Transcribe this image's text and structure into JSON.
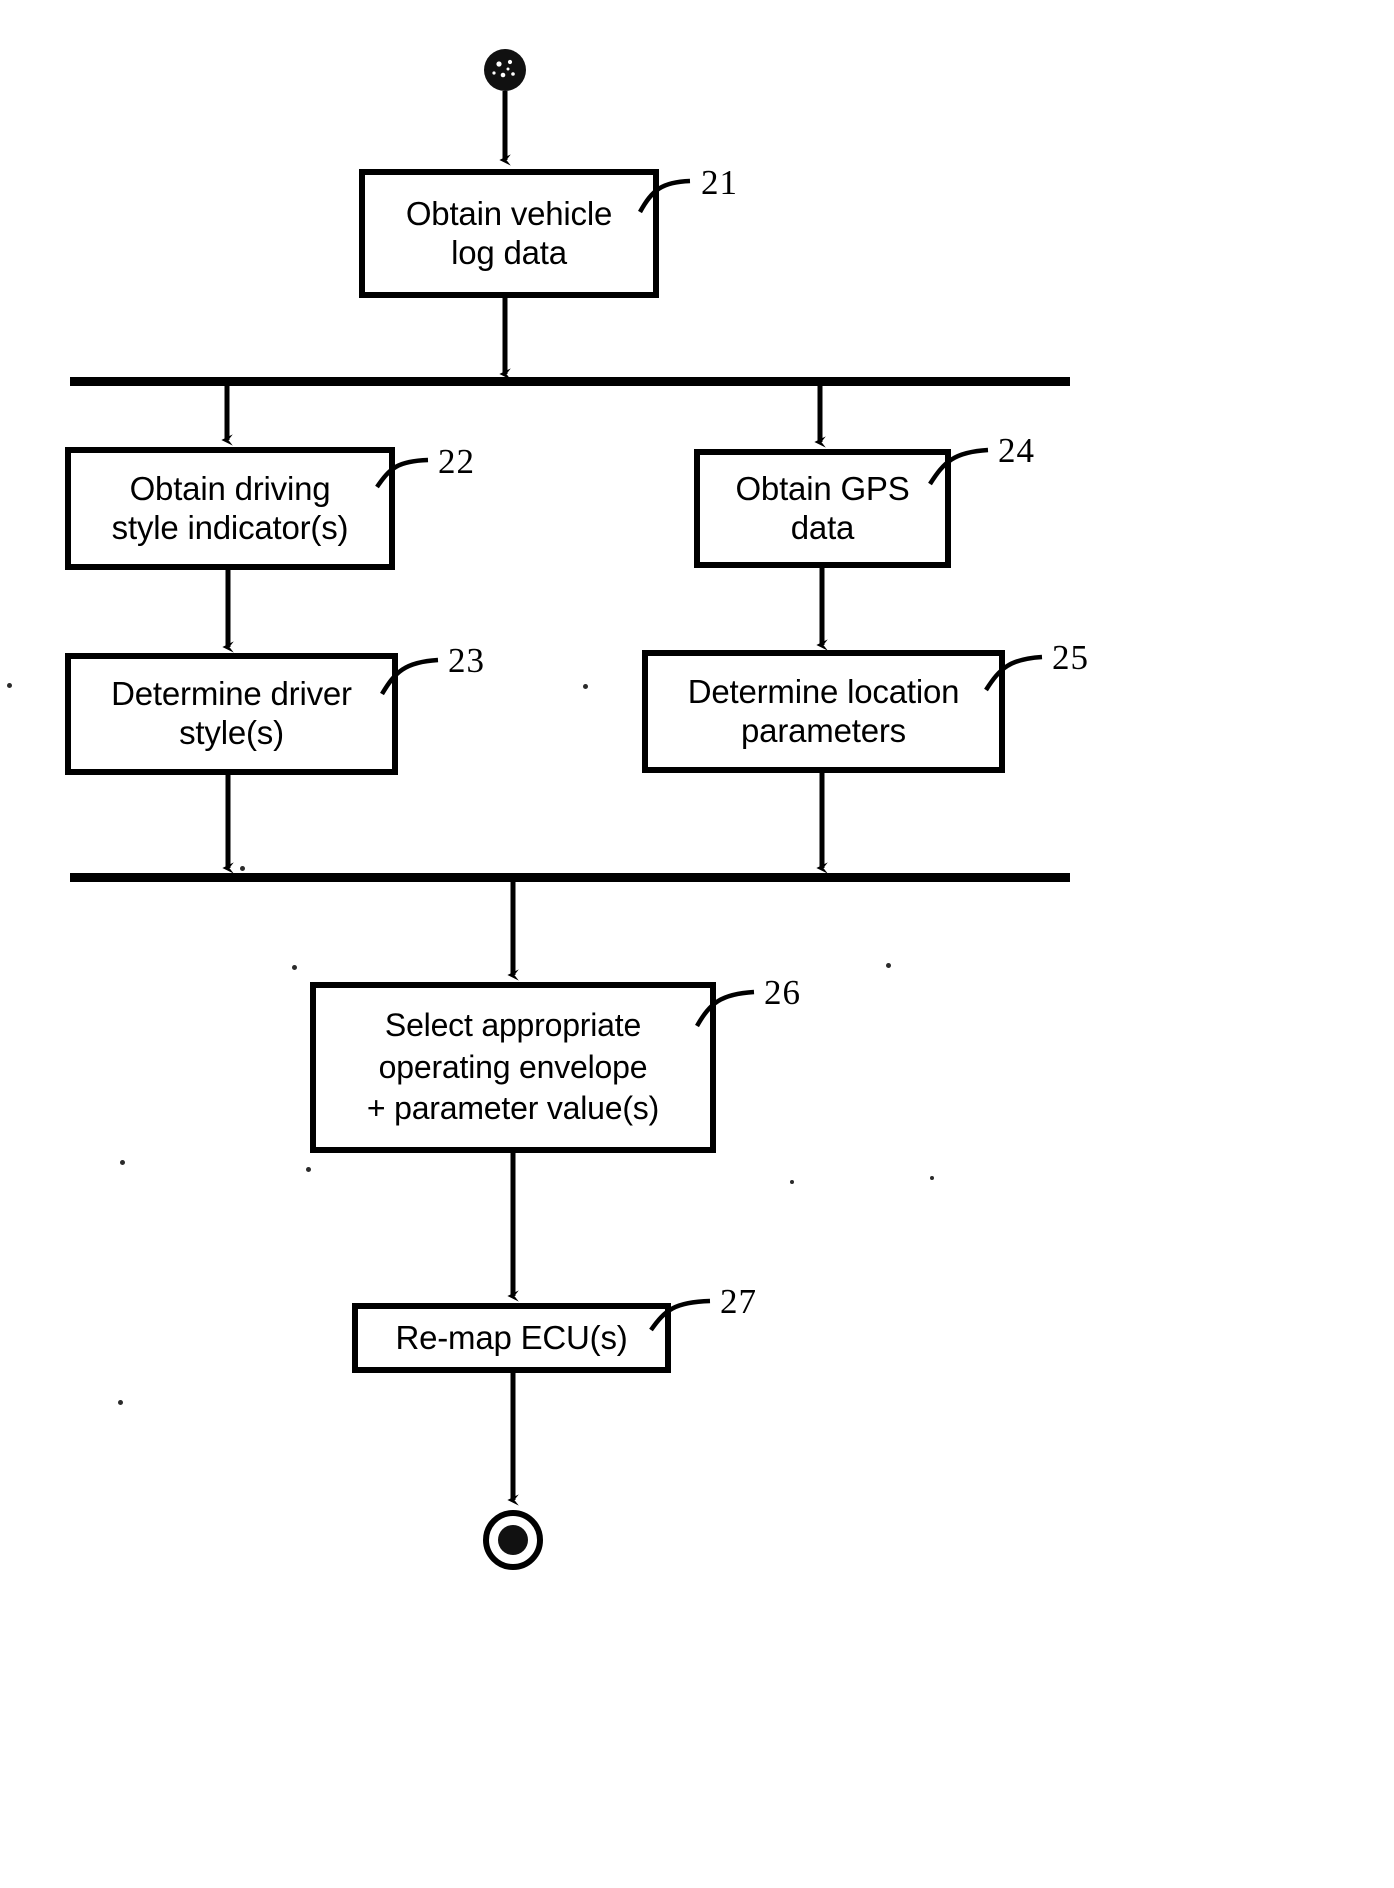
{
  "figure": {
    "type": "activity-flowchart",
    "title": "",
    "nodes": [
      {
        "id": "start",
        "kind": "start-node",
        "label": ""
      },
      {
        "id": "21",
        "kind": "process",
        "ref": "21",
        "label": "Obtain vehicle\nlog data"
      },
      {
        "id": "fork",
        "kind": "fork-bar",
        "label": ""
      },
      {
        "id": "22",
        "kind": "process",
        "ref": "22",
        "label": "Obtain driving\nstyle indicator(s)"
      },
      {
        "id": "24",
        "kind": "process",
        "ref": "24",
        "label": "Obtain GPS\ndata"
      },
      {
        "id": "23",
        "kind": "process",
        "ref": "23",
        "label": "Determine driver\nstyle(s)"
      },
      {
        "id": "25",
        "kind": "process",
        "ref": "25",
        "label": "Determine location\nparameters"
      },
      {
        "id": "join",
        "kind": "join-bar",
        "label": ""
      },
      {
        "id": "26",
        "kind": "process",
        "ref": "26",
        "label": "Select appropriate\noperating envelope\n+ parameter value(s)"
      },
      {
        "id": "27",
        "kind": "process",
        "ref": "27",
        "label": "Re-map ECU(s)"
      },
      {
        "id": "end",
        "kind": "end-node",
        "label": ""
      }
    ],
    "ref_numerals": [
      "21",
      "22",
      "23",
      "24",
      "25",
      "26",
      "27"
    ],
    "colors": {
      "stroke": "#000000",
      "fill": "#ffffff",
      "text": "#000000"
    }
  }
}
